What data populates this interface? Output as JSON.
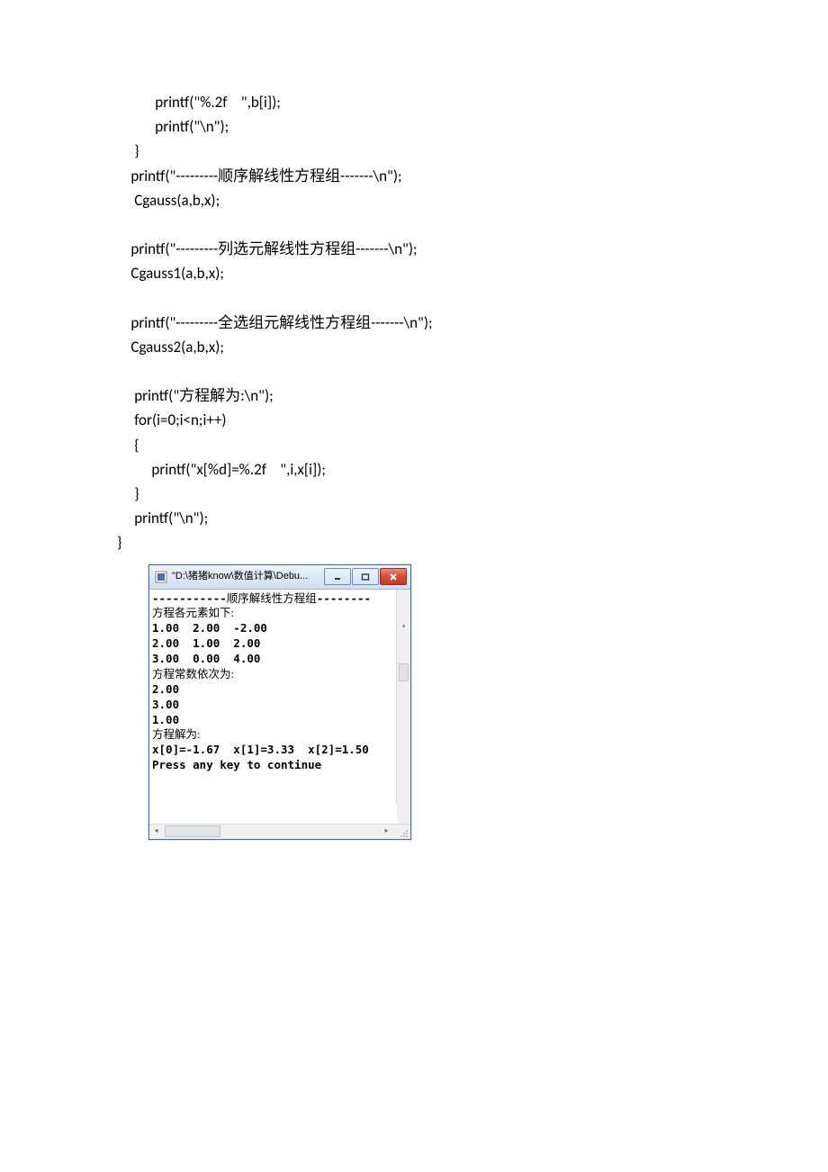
{
  "code": {
    "l1": "           printf(\"%.2f    \",b[i]);",
    "l2": "           printf(\"\\n\");",
    "l3": "     }",
    "l4": "    printf(\"---------顺序解线性方程组-------\\n\");",
    "l5": "     Cgauss(a,b,x);",
    "l6": "",
    "l7": "    printf(\"---------列选元解线性方程组-------\\n\");",
    "l8": "    Cgauss1(a,b,x);",
    "l9": "",
    "l10": "    printf(\"---------全选组元解线性方程组-------\\n\");",
    "l11": "    Cgauss2(a,b,x);",
    "l12": "",
    "l13": "     printf(\"方程解为:\\n\");",
    "l14": "     for(i=0;i<n;i++)",
    "l15": "     {",
    "l16": "          printf(\"x[%d]=%.2f    \",i,x[i]);",
    "l17": "     }",
    "l18": "     printf(\"\\n\");",
    "l19": "}"
  },
  "console": {
    "title": "\"D:\\猪猪know\\数值计算\\Debu...",
    "lines": {
      "h1_pre": "-----------",
      "h1_cn": "顺序解线性方程组",
      "h1_post": "--------",
      "l2": "方程各元素如下:",
      "l3": "1.00  2.00  -2.00",
      "l4": "2.00  1.00  2.00",
      "l5": "3.00  0.00  4.00",
      "l6": "方程常数依次为:",
      "l7": "2.00",
      "l8": "3.00",
      "l9": "1.00",
      "l10": "方程解为:",
      "l11": "x[0]=-1.67  x[1]=3.33  x[2]=1.50",
      "l12": "Press any key to continue"
    }
  }
}
